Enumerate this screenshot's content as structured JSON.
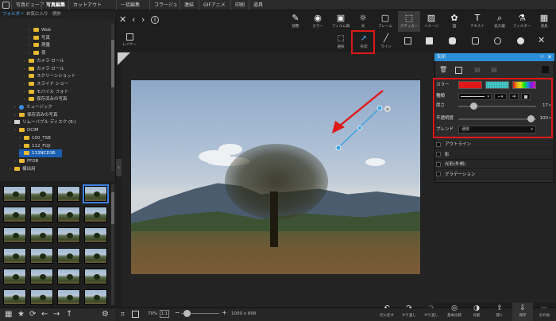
{
  "menubar": {
    "items": [
      "写真ビューア",
      "写真編集",
      "カットアウト",
      "一括編集",
      "コラージュ",
      "連結",
      "GIFアニメ",
      "印刷",
      "道具"
    ],
    "active_index": 1
  },
  "left_tabs": [
    "フォルダー",
    "お気に入り",
    "例外"
  ],
  "tree": [
    {
      "label": "Web",
      "icon": "folder",
      "indent": 5
    },
    {
      "label": "写真",
      "icon": "folder",
      "indent": 5
    },
    {
      "label": "測量",
      "icon": "folder",
      "indent": 5
    },
    {
      "label": "夜",
      "icon": "folder",
      "indent": 5
    },
    {
      "label": "カメラ ロール",
      "icon": "folder",
      "indent": 4
    },
    {
      "label": "カメラ ロール",
      "icon": "folder",
      "indent": 4
    },
    {
      "label": "スクリーンショット",
      "icon": "folder",
      "indent": 4
    },
    {
      "label": "スライド ショー",
      "icon": "folder",
      "indent": 4
    },
    {
      "label": "モバイル フォト",
      "icon": "folder",
      "indent": 4
    },
    {
      "label": "保存済みの写真",
      "icon": "folder",
      "indent": 4
    },
    {
      "label": "ミュージック",
      "icon": "music",
      "indent": 2
    },
    {
      "label": "保存済みの写真",
      "icon": "folder",
      "indent": 2
    },
    {
      "label": "リムーバブル ディスク (E:)",
      "icon": "drive",
      "indent": 1
    },
    {
      "label": "DCIM",
      "icon": "folder",
      "indent": 2
    },
    {
      "label": "100_TSB",
      "icon": "folder",
      "indent": 3
    },
    {
      "label": "112_FUJI",
      "icon": "folder",
      "indent": 3
    },
    {
      "label": "113NCD36",
      "icon": "folder",
      "indent": 3,
      "selected": true
    },
    {
      "label": "FFDB",
      "icon": "folder",
      "indent": 2
    },
    {
      "label": "構出用",
      "icon": "folder",
      "indent": 1
    }
  ],
  "toolbar": [
    {
      "label": "調整",
      "icon": "adjust-icon"
    },
    {
      "label": "カラー",
      "icon": "color-icon"
    },
    {
      "label": "フィルム調",
      "icon": "film-icon"
    },
    {
      "label": "光",
      "icon": "light-icon"
    },
    {
      "label": "フレーム",
      "icon": "frame-icon"
    },
    {
      "label": "ステッカー",
      "icon": "sticker-icon"
    },
    {
      "label": "イメージ",
      "icon": "image-icon"
    },
    {
      "label": "図",
      "icon": "shape-icon"
    },
    {
      "label": "テキスト",
      "icon": "text-icon"
    },
    {
      "label": "拡大鏡",
      "icon": "magnifier-icon"
    },
    {
      "label": "フィルター",
      "icon": "filter-icon"
    },
    {
      "label": "道具",
      "icon": "tools-icon"
    }
  ],
  "subtoolbar": {
    "layer_label": "レイヤー",
    "select_label": "選択",
    "arrow_label": "矢印",
    "line_label": "ライン"
  },
  "panel": {
    "title": "矢印",
    "color_label": "カラー",
    "type_label": "種類",
    "thickness_label": "厚さ",
    "thickness_value": "17",
    "opacity_label": "不透明度",
    "opacity_value": "100",
    "blend_label": "ブレンド",
    "blend_value": "通常",
    "options": [
      "アウトライン",
      "影",
      "光彩(外側)",
      "グラデーション"
    ],
    "fill_color": "#e01818",
    "pattern_color": "#4ecfcf"
  },
  "bottombar": {
    "zoom_value": "70%",
    "ratio_label": "1:1",
    "image_size": "1000 x 668",
    "buttons": [
      "元に戻す",
      "やり直し",
      "やり直し",
      "基本比較",
      "比較",
      "開く",
      "保存",
      "その他"
    ]
  },
  "colors": {
    "accent": "#2a8fd8",
    "highlight_red": "#e01818"
  }
}
